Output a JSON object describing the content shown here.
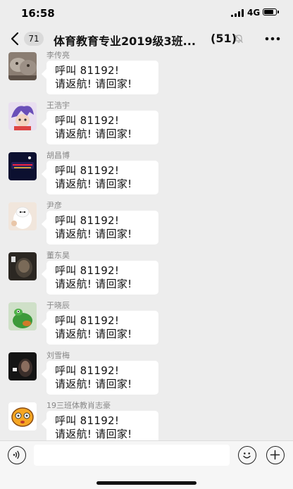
{
  "status_bar": {
    "time": "16:58",
    "network": "4G"
  },
  "nav": {
    "unread_count": "71",
    "title": "体育教育专业2019级3班...",
    "member_count": "(51)"
  },
  "messages": [
    {
      "sender": "李传亮",
      "line1": "呼叫 81192!",
      "line2": "请返航! 请回家!"
    },
    {
      "sender": "王浩宇",
      "line1": "呼叫 81192!",
      "line2": "请返航! 请回家!"
    },
    {
      "sender": "胡昌博",
      "line1": "呼叫 81192!",
      "line2": "请返航! 请回家!"
    },
    {
      "sender": "尹彦",
      "line1": "呼叫 81192!",
      "line2": "请返航! 请回家!"
    },
    {
      "sender": "董东昊",
      "line1": "呼叫 81192!",
      "line2": "请返航! 请回家!"
    },
    {
      "sender": "于晓辰",
      "line1": "呼叫 81192!",
      "line2": "请返航! 请回家!"
    },
    {
      "sender": "刘雪梅",
      "line1": "呼叫 81192!",
      "line2": "请返航! 请回家!"
    },
    {
      "sender": "19三班体教肖志豪",
      "line1": "呼叫 81192!",
      "line2": "请返航! 请回家!"
    }
  ],
  "input": {
    "value": "",
    "placeholder": ""
  },
  "icons": {
    "back": "chevron-left-icon",
    "mute": "bell-mute-icon",
    "more": "more-icon",
    "voice": "voice-icon",
    "emoji": "emoji-icon",
    "plus": "plus-icon"
  },
  "colors": {
    "background": "#ededed",
    "bubble": "#ffffff",
    "sender_text": "#888888"
  }
}
